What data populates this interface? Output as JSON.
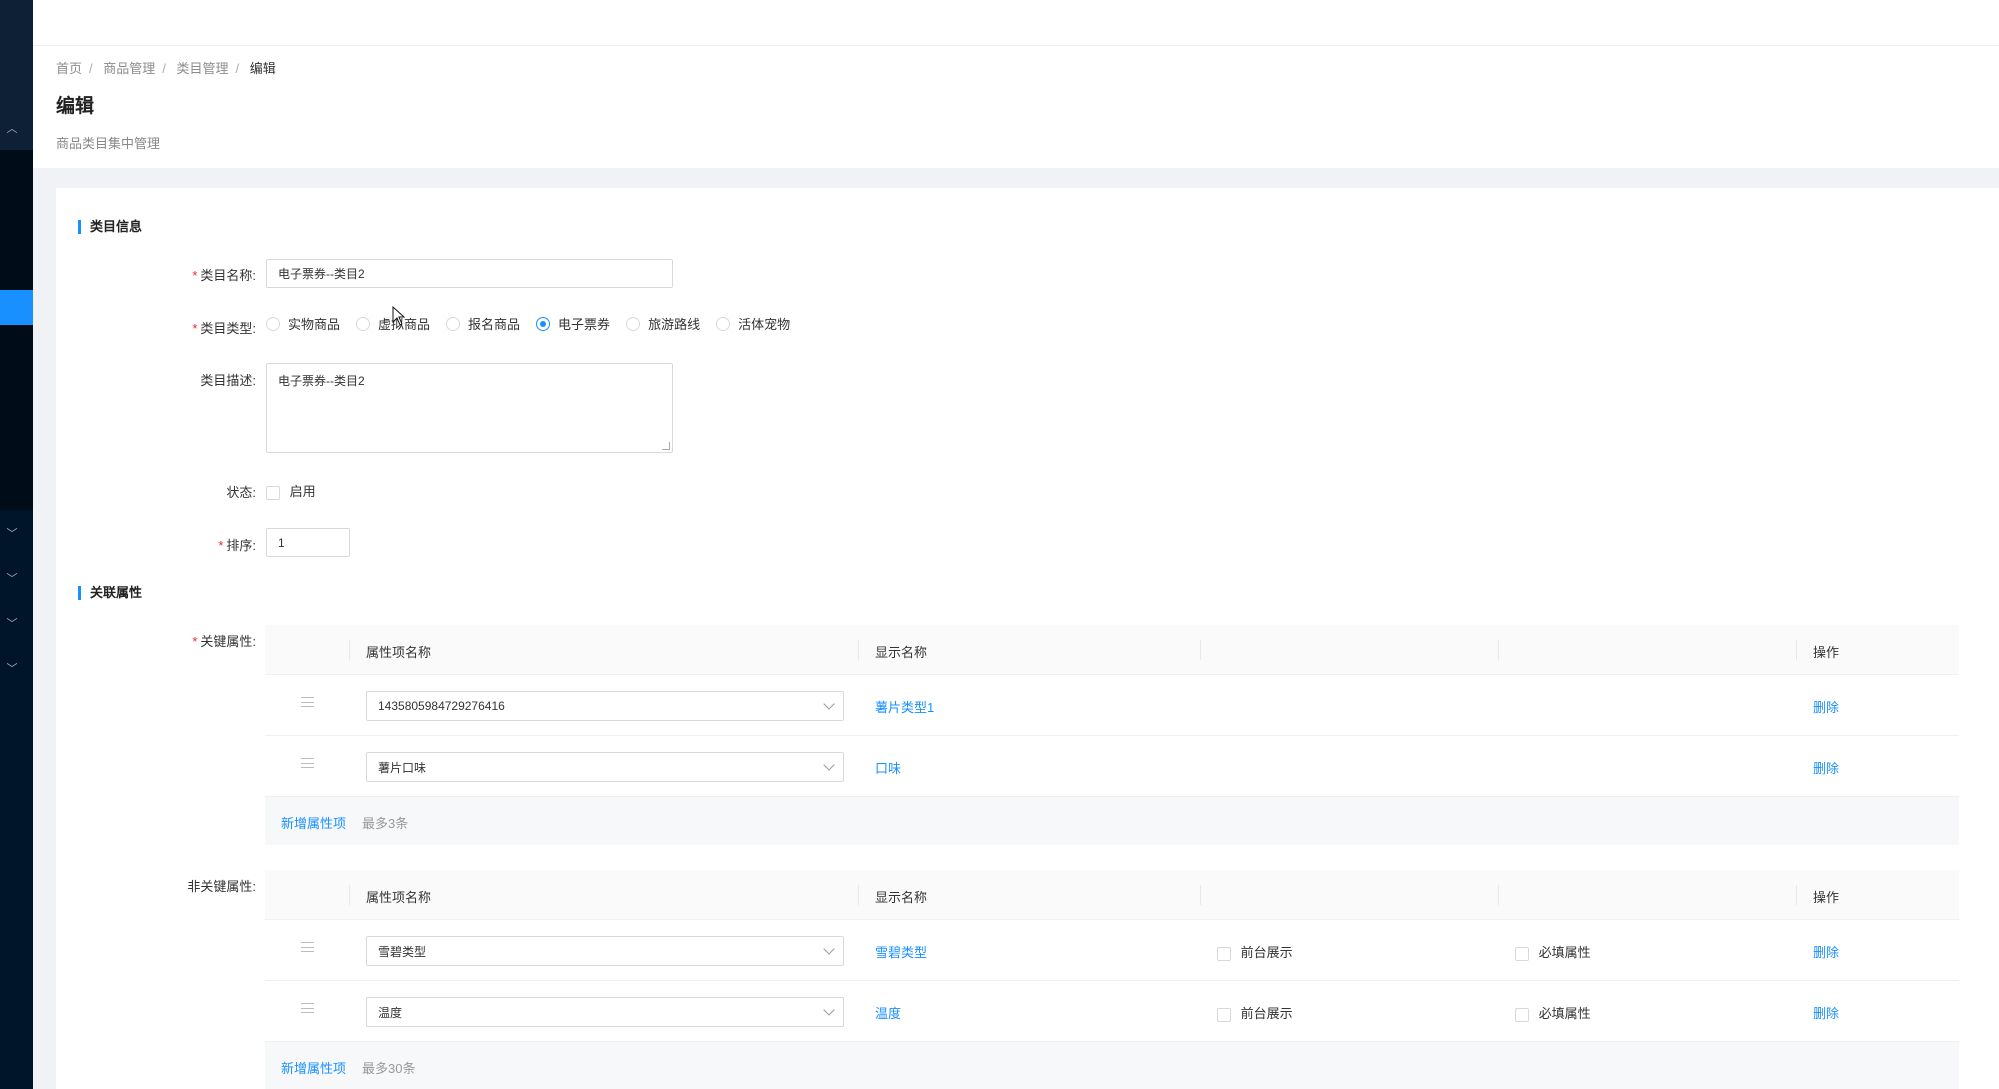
{
  "breadcrumb": [
    "首页",
    "商品管理",
    "类目管理",
    "编辑"
  ],
  "page": {
    "title": "编辑",
    "desc": "商品类目集中管理"
  },
  "sections": {
    "info": "类目信息",
    "attrs": "关联属性"
  },
  "form": {
    "name_label": "类目名称:",
    "name_value": "电子票券--类目2",
    "type_label": "类目类型:",
    "type_options": [
      "实物商品",
      "虚拟商品",
      "报名商品",
      "电子票券",
      "旅游路线",
      "活体宠物"
    ],
    "type_selected": "电子票券",
    "desc_label": "类目描述:",
    "desc_value": "电子票券--类目2",
    "status_label": "状态:",
    "status_option": "启用",
    "sort_label": "排序:",
    "sort_value": "1"
  },
  "key_attrs": {
    "label": "关键属性:",
    "headers": {
      "name": "属性项名称",
      "display": "显示名称",
      "op": "操作"
    },
    "rows": [
      {
        "select": "1435805984729276416",
        "display": "薯片类型1",
        "op": "删除"
      },
      {
        "select": "薯片口味",
        "display": "口味",
        "op": "删除"
      }
    ],
    "add": "新增属性项",
    "hint": "最多3条"
  },
  "nonkey_attrs": {
    "label": "非关键属性:",
    "headers": {
      "name": "属性项名称",
      "display": "显示名称",
      "op": "操作"
    },
    "rows": [
      {
        "select": "雪碧类型",
        "display": "雪碧类型",
        "front": "前台展示",
        "required": "必填属性",
        "op": "删除"
      },
      {
        "select": "温度",
        "display": "温度",
        "front": "前台展示",
        "required": "必填属性",
        "op": "删除"
      }
    ],
    "add": "新增属性项",
    "hint": "最多30条"
  },
  "colors": {
    "primary": "#1890ff",
    "sidebar": "#001529",
    "required": "#f5222d"
  }
}
